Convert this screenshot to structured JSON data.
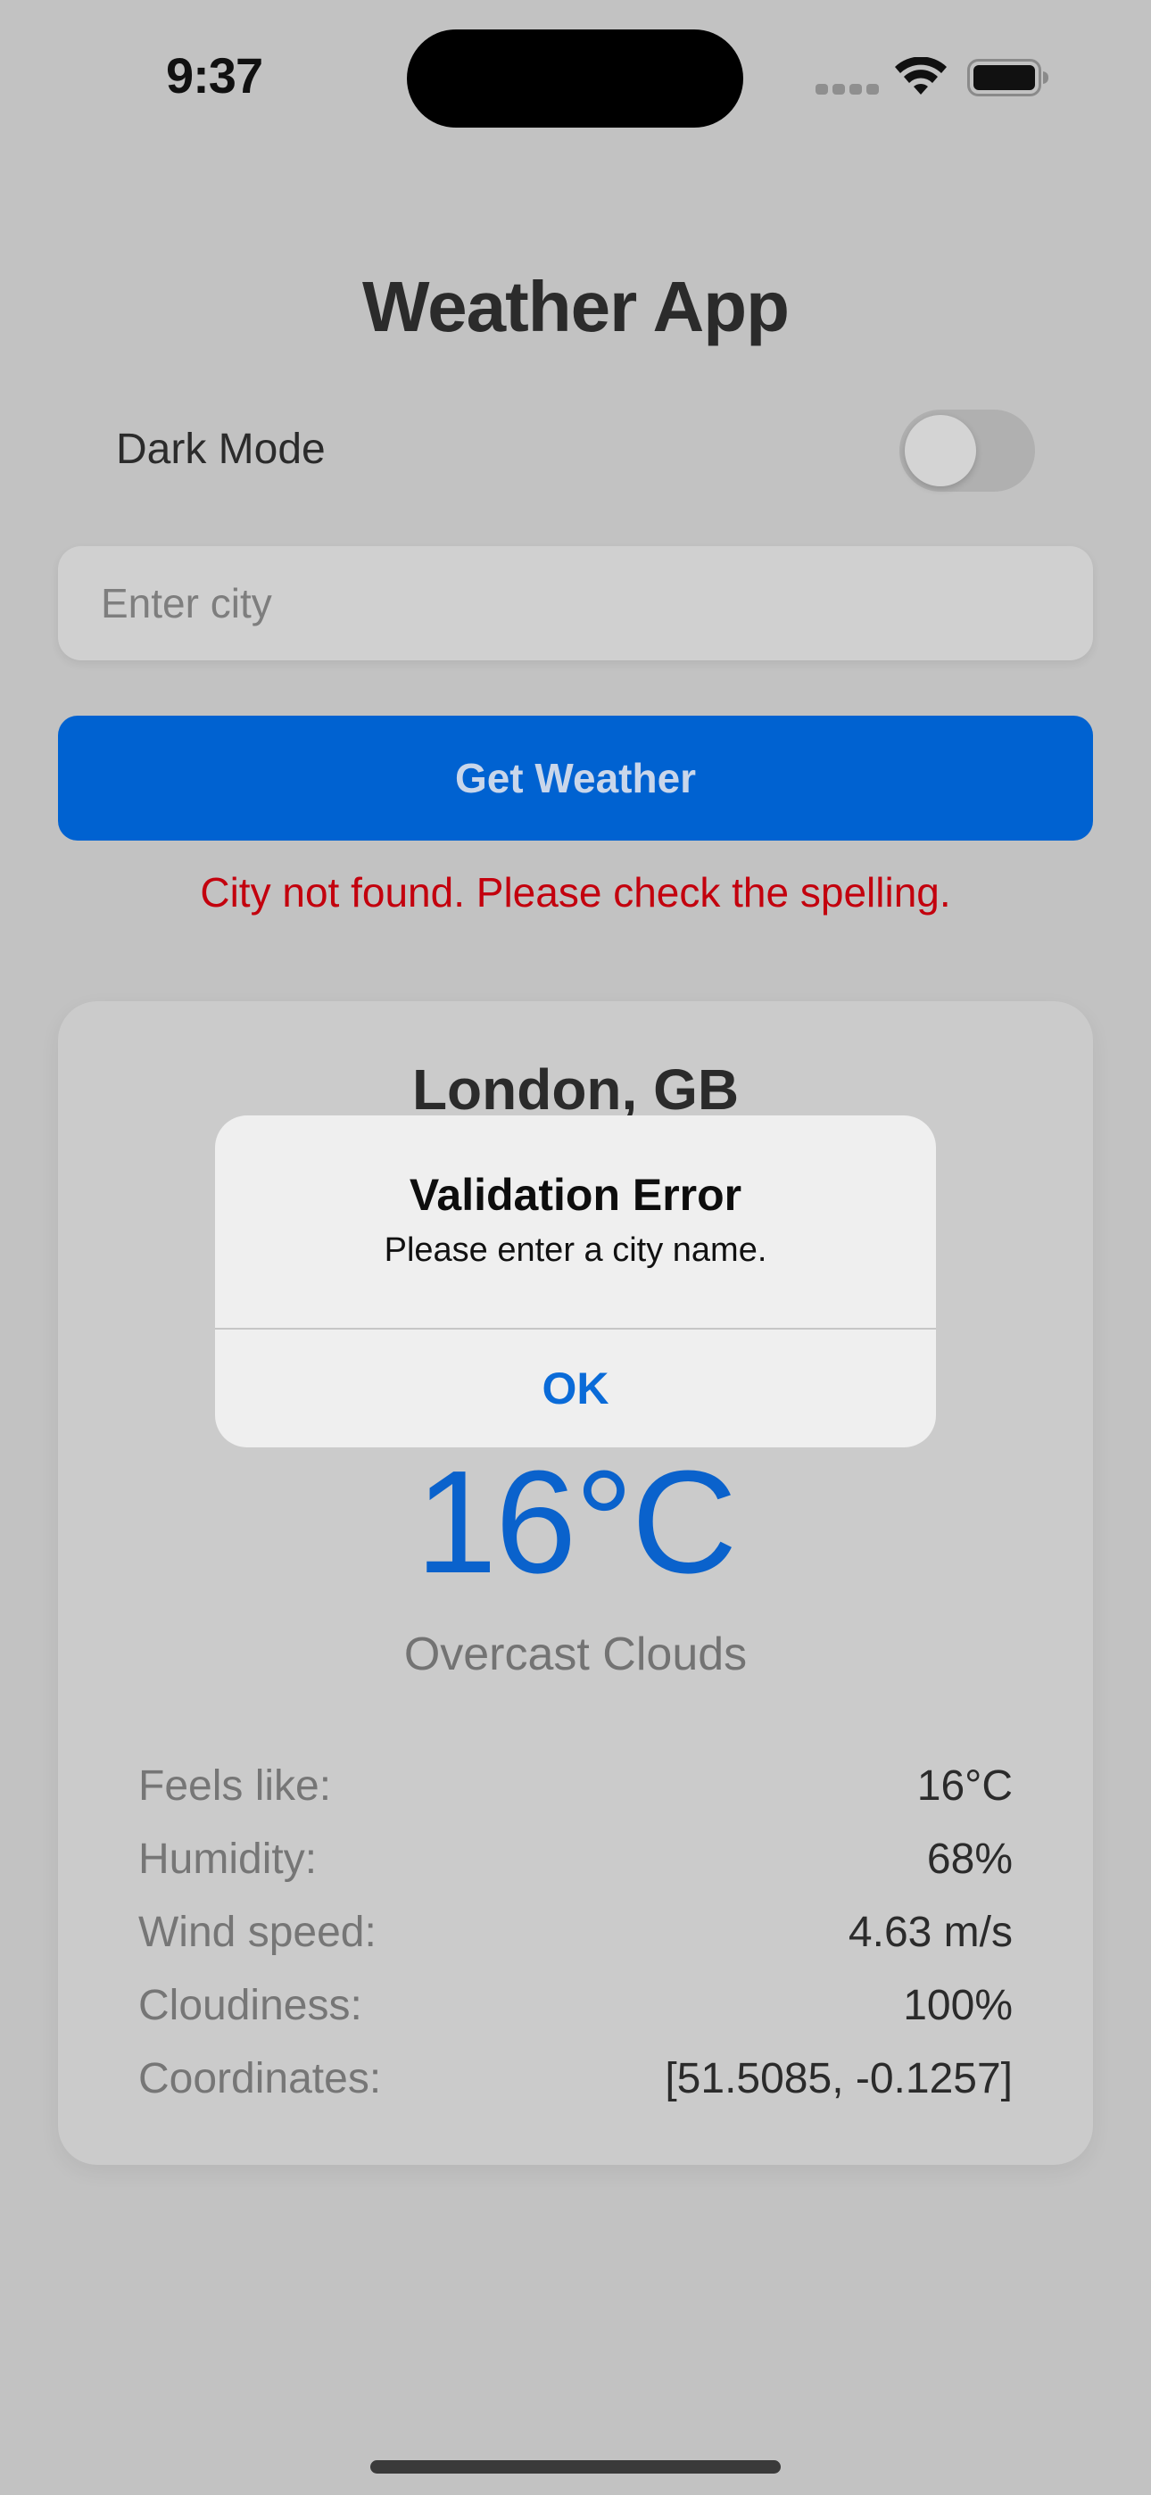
{
  "status_bar": {
    "time": "9:37"
  },
  "header": {
    "title": "Weather App"
  },
  "settings": {
    "dark_mode_label": "Dark Mode",
    "dark_mode_enabled": false
  },
  "search": {
    "placeholder": "Enter city",
    "value": "",
    "button_label": "Get Weather"
  },
  "error": {
    "message": "City not found. Please check the spelling."
  },
  "weather": {
    "city": "London, GB",
    "temperature": "16°C",
    "description": "Overcast Clouds",
    "details": [
      {
        "label": "Feels like:",
        "value": "16°C"
      },
      {
        "label": "Humidity:",
        "value": "68%"
      },
      {
        "label": "Wind speed:",
        "value": "4.63 m/s"
      },
      {
        "label": "Cloudiness:",
        "value": "100%"
      },
      {
        "label": "Coordinates:",
        "value": "[51.5085, -0.1257]"
      }
    ]
  },
  "alert": {
    "title": "Validation Error",
    "message": "Please enter a city name.",
    "ok_label": "OK"
  },
  "colors": {
    "background": "#c2c2c2",
    "accent": "#0062d1",
    "error": "#c3000d",
    "temperature": "#0a62cc"
  }
}
